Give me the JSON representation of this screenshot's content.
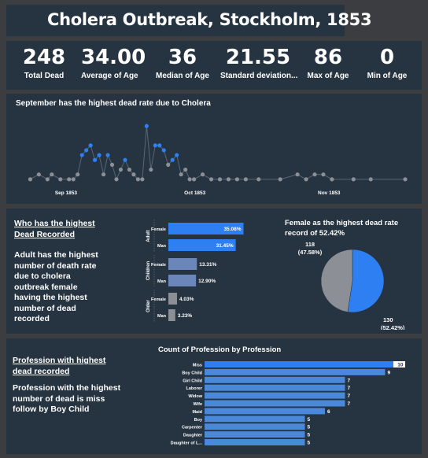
{
  "header": {
    "title": "Cholera Outbreak, Stockholm, 1853"
  },
  "kpis": [
    {
      "value": "248",
      "label": "Total Dead"
    },
    {
      "value": "34.00",
      "label": "Average of Age"
    },
    {
      "value": "36",
      "label": "Median of Age"
    },
    {
      "value": "21.55",
      "label": "Standard deviation..."
    },
    {
      "value": "86",
      "label": "Max of Age"
    },
    {
      "value": "0",
      "label": "Min of Age"
    }
  ],
  "timeline": {
    "title": "September has the highest dead rate due to Cholera"
  },
  "gender": {
    "heading": "Who has the highest Dead Recorded",
    "body": "Adult has the highest number of death rate due to cholera outbreak female having the highest number of dead recorded",
    "pie_title": "Female as the highest dead rate record of 52.42%"
  },
  "profession": {
    "heading": "Profession with highest dead recorded",
    "body": "Profession with the highest number of dead is miss follow by Boy Child",
    "chart_title": "Count of Profession by Profession"
  },
  "colors": {
    "background": "#3b3d40",
    "panel": "#263340",
    "accent_blue": "#2e7ff2",
    "muted_blue": "#6b87b9",
    "gray": "#8c9096",
    "line": "#586777"
  },
  "chart_data": [
    {
      "type": "line",
      "title": "September has the highest dead rate due to Cholera",
      "x_tick_labels": [
        "Sep 1853",
        "Oct 1853",
        "Nov 1853"
      ],
      "x": [
        "1853-08-27",
        "1853-08-29",
        "1853-08-31",
        "1853-09-01",
        "1853-09-03",
        "1853-09-05",
        "1853-09-06",
        "1853-09-07",
        "1853-09-08",
        "1853-09-09",
        "1853-09-10",
        "1853-09-11",
        "1853-09-12",
        "1853-09-13",
        "1853-09-14",
        "1853-09-15",
        "1853-09-16",
        "1853-09-17",
        "1853-09-18",
        "1853-09-19",
        "1853-09-20",
        "1853-09-21",
        "1853-09-22",
        "1853-09-23",
        "1853-09-24",
        "1853-09-25",
        "1853-09-26",
        "1853-09-27",
        "1853-09-28",
        "1853-09-29",
        "1853-09-30",
        "1853-10-01",
        "1853-10-02",
        "1853-10-03",
        "1853-10-04",
        "1853-10-06",
        "1853-10-08",
        "1853-10-10",
        "1853-10-12",
        "1853-10-14",
        "1853-10-16",
        "1853-10-19",
        "1853-10-24",
        "1853-10-28",
        "1853-10-30",
        "1853-11-01",
        "1853-11-03",
        "1853-11-05",
        "1853-11-10",
        "1853-11-14",
        "1853-11-22"
      ],
      "values": [
        1,
        2,
        1,
        2,
        1,
        1,
        1,
        2,
        6,
        7,
        8,
        5,
        6,
        2,
        6,
        4,
        1,
        3,
        5,
        3,
        2,
        1,
        1,
        12,
        3,
        8,
        8,
        7,
        4,
        5,
        6,
        2,
        3,
        1,
        1,
        2,
        1,
        1,
        1,
        1,
        1,
        1,
        1,
        2,
        1,
        2,
        2,
        1,
        1,
        1,
        1
      ],
      "ylim": [
        0,
        13
      ],
      "highlighted_color": "#2e7ff2",
      "default_color": "#8c9096"
    },
    {
      "type": "bar",
      "orientation": "horizontal",
      "groups": [
        "Adult",
        "Children",
        "Older"
      ],
      "categories": [
        "Female",
        "Man"
      ],
      "values": [
        [
          35.08,
          31.45
        ],
        [
          13.31,
          12.9
        ],
        [
          4.03,
          3.23
        ]
      ],
      "labels": [
        [
          "35.08%",
          "31.45%"
        ],
        [
          "13.31%",
          "12.90%"
        ],
        [
          "4.03%",
          "3.23%"
        ]
      ],
      "xlim": [
        0,
        36
      ]
    },
    {
      "type": "pie",
      "title": "Female as the highest dead rate record of 52.42%",
      "slices": [
        {
          "count": 130,
          "percent": 52.42,
          "count_label": "130",
          "pct_label": "(52.42%)",
          "color": "#2e7ff2"
        },
        {
          "count": 118,
          "percent": 47.58,
          "count_label": "118",
          "pct_label": "(47.58%)",
          "color": "#8c9096"
        }
      ]
    },
    {
      "type": "bar",
      "orientation": "horizontal",
      "title": "Count of Profession by Profession",
      "categories": [
        "Miss",
        "Boy Child",
        "Girl Child",
        "Laborer",
        "Widow",
        "Wife",
        "Maid",
        "Boy",
        "Carpenter",
        "Daughter",
        "Daughter of L..."
      ],
      "values": [
        10,
        9,
        7,
        7,
        7,
        7,
        6,
        5,
        5,
        5,
        5
      ],
      "xlim": [
        0,
        10
      ]
    }
  ]
}
